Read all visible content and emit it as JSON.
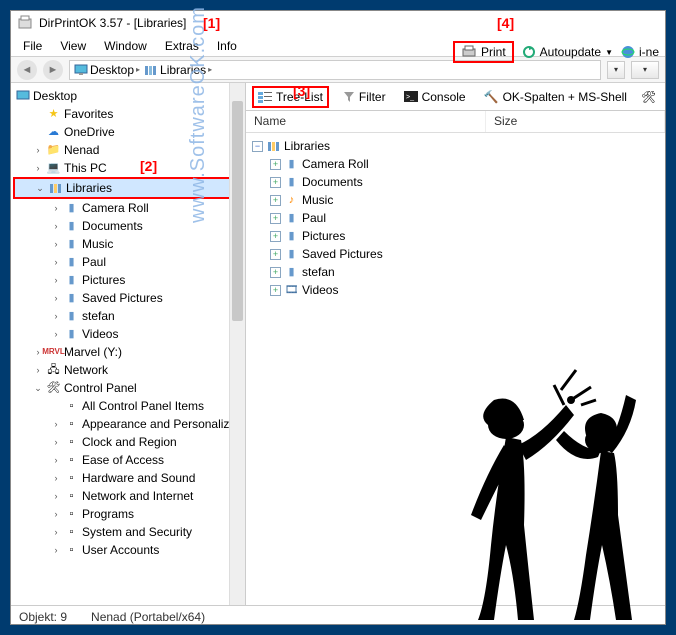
{
  "title": "DirPrintOK 3.57 - [Libraries]",
  "menus": [
    "File",
    "View",
    "Window",
    "Extras",
    "Info"
  ],
  "topbuttons": {
    "print": "Print",
    "autoupdate": "Autoupdate",
    "inet": "i-ne"
  },
  "breadcrumb": {
    "seg1": "Desktop",
    "seg2": "Libraries"
  },
  "left_tree": {
    "root": "Desktop",
    "items": [
      {
        "label": "Favorites",
        "icon": "star"
      },
      {
        "label": "OneDrive",
        "icon": "cloud"
      },
      {
        "label": "Nenad",
        "icon": "folder"
      },
      {
        "label": "This PC",
        "icon": "pc"
      },
      {
        "label": "Libraries",
        "icon": "lib",
        "selected": true,
        "children": [
          {
            "label": "Camera Roll",
            "icon": "lib"
          },
          {
            "label": "Documents",
            "icon": "lib"
          },
          {
            "label": "Music",
            "icon": "lib"
          },
          {
            "label": "Paul",
            "icon": "lib"
          },
          {
            "label": "Pictures",
            "icon": "lib"
          },
          {
            "label": "Saved Pictures",
            "icon": "lib"
          },
          {
            "label": "stefan",
            "icon": "lib"
          },
          {
            "label": "Videos",
            "icon": "lib"
          }
        ]
      },
      {
        "label": "Marvel (Y:)",
        "icon": "drive"
      },
      {
        "label": "Network",
        "icon": "net"
      },
      {
        "label": "Control Panel",
        "icon": "cp",
        "children": [
          {
            "label": "All Control Panel Items",
            "icon": "cp"
          },
          {
            "label": "Appearance and Personalizat",
            "icon": "cp"
          },
          {
            "label": "Clock and Region",
            "icon": "cp"
          },
          {
            "label": "Ease of Access",
            "icon": "cp"
          },
          {
            "label": "Hardware and Sound",
            "icon": "cp"
          },
          {
            "label": "Network and Internet",
            "icon": "cp"
          },
          {
            "label": "Programs",
            "icon": "cp"
          },
          {
            "label": "System and Security",
            "icon": "cp"
          },
          {
            "label": "User Accounts",
            "icon": "cp"
          }
        ]
      }
    ]
  },
  "toolbar2": {
    "treelist": "Tree-List",
    "filter": "Filter",
    "console": "Console",
    "okspalten": "OK-Spalten + MS-Shell"
  },
  "columns": {
    "name": "Name",
    "size": "Size"
  },
  "file_tree": {
    "root": "Libraries",
    "items": [
      "Camera Roll",
      "Documents",
      "Music",
      "Paul",
      "Pictures",
      "Saved Pictures",
      "stefan",
      "Videos"
    ]
  },
  "status": {
    "objekt": "Objekt: 9",
    "user": "Nenad (Portabel/x64)"
  },
  "annotations": {
    "a1": "[1]",
    "a2": "[2]",
    "a3": "[3]",
    "a4": "[4]"
  },
  "watermark": "www.SoftwareOK.com :-)"
}
